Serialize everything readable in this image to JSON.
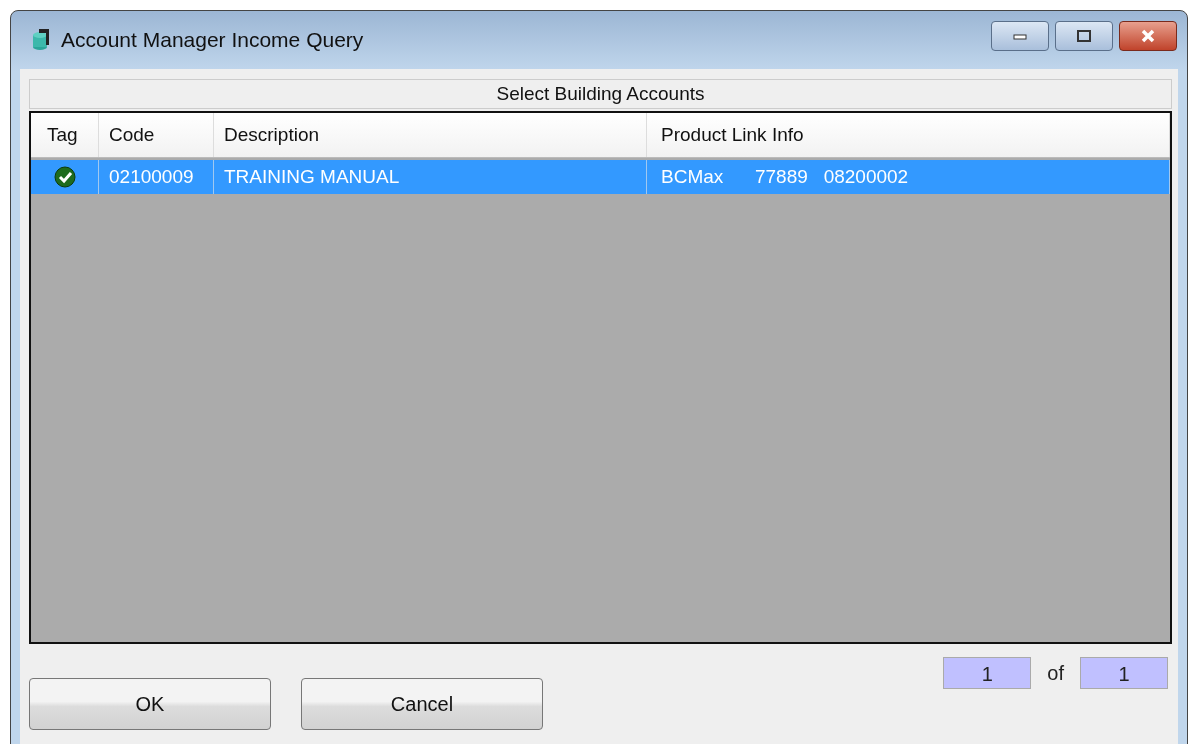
{
  "window": {
    "title": "Account Manager Income Query"
  },
  "panel": {
    "title": "Select Building Accounts"
  },
  "table": {
    "columns": [
      "Tag",
      "Code",
      "Description",
      "Product Link Info"
    ],
    "rows": [
      {
        "tagged": true,
        "selected": true,
        "code": "02100009",
        "description": "TRAINING MANUAL",
        "product_link_info": "BCMax      77889   08200002"
      }
    ]
  },
  "pager": {
    "current": "1",
    "of": "of",
    "total": "1"
  },
  "buttons": [
    "OK",
    "Cancel"
  ]
}
